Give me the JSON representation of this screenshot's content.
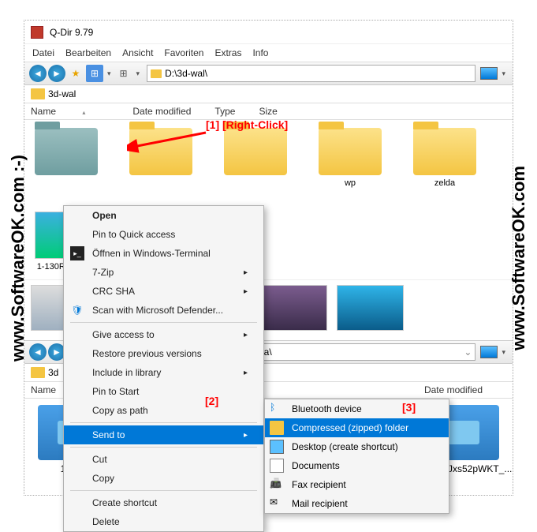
{
  "watermark_left": "www.SoftwareOK.com  :-)",
  "watermark_right": "www.SoftwareOK.com",
  "window": {
    "title": "Q-Dir 9.79"
  },
  "menu": {
    "datei": "Datei",
    "bearbeiten": "Bearbeiten",
    "ansicht": "Ansicht",
    "favoriten": "Favoriten",
    "extras": "Extras",
    "info": "Info"
  },
  "address": {
    "path": "D:\\3d-wal\\",
    "breadcrumb": "3d-wal"
  },
  "columns": {
    "name": "Name",
    "date": "Date modified",
    "type": "Type",
    "size": "Size"
  },
  "folders": {
    "wp": "wp",
    "zelda": "zelda",
    "thumb1": "1-130R6205U5"
  },
  "annotations": {
    "a1": "[1] [Right-Click]",
    "a2": "[2]",
    "a3": "[3]"
  },
  "context": {
    "open": "Open",
    "pin_quick": "Pin to Quick access",
    "open_terminal": "Öffnen in Windows-Terminal",
    "sevenzip": "7-Zip",
    "crc": "CRC SHA",
    "defender": "Scan with Microsoft Defender...",
    "give_access": "Give access to",
    "restore": "Restore previous versions",
    "include_lib": "Include in library",
    "pin_start": "Pin to Start",
    "copy_path": "Copy as path",
    "send_to": "Send to",
    "cut": "Cut",
    "copy": "Copy",
    "create_shortcut": "Create shortcut",
    "delete": "Delete"
  },
  "submenu": {
    "bluetooth": "Bluetooth device",
    "compressed": "Compressed (zipped) folder",
    "desktop": "Desktop (create shortcut)",
    "documents": "Documents",
    "fax": "Fax recipient",
    "mail": "Mail recipient"
  },
  "lower": {
    "addr": "da\\",
    "bc": "3d",
    "item1": "1920x",
    "item2": "JCw5Jxs52pWKT_..."
  }
}
